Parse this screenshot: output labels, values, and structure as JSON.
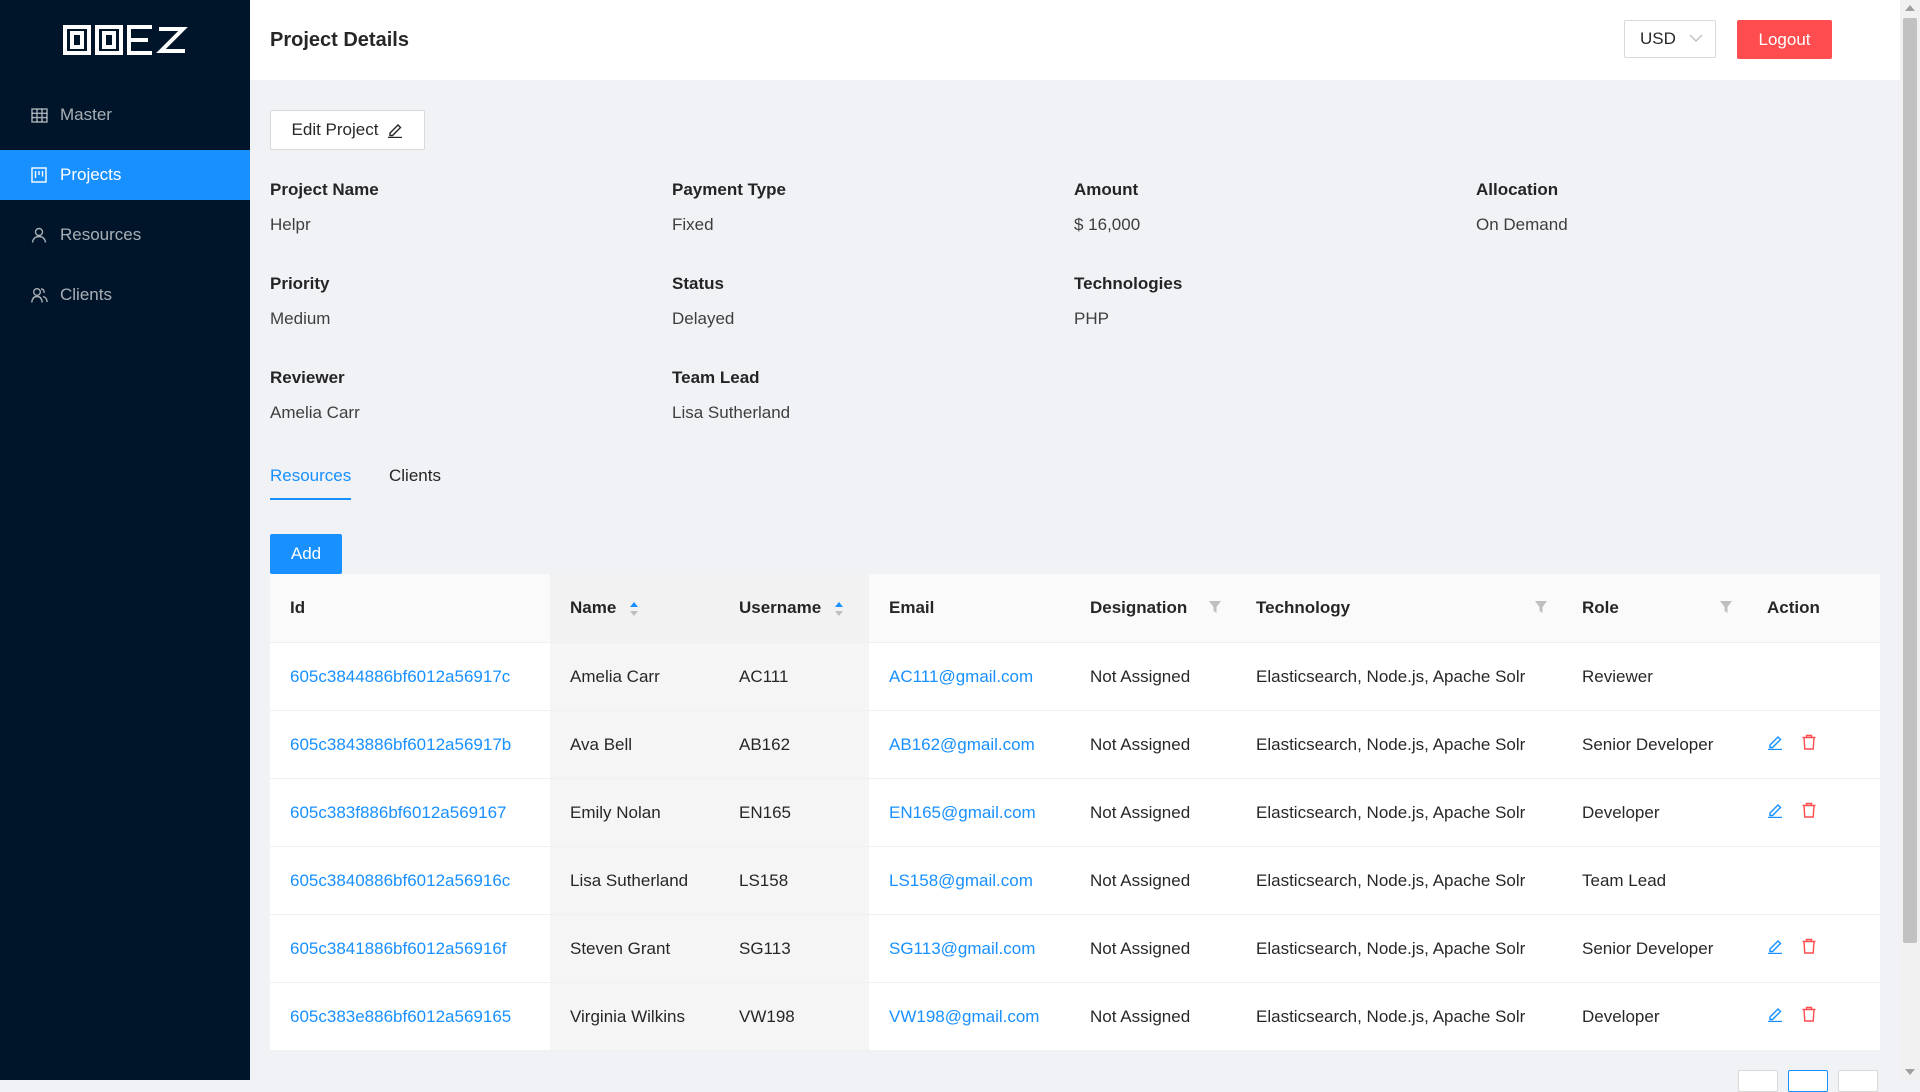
{
  "app": {
    "logo_text": "DOEZ"
  },
  "sidebar": {
    "items": [
      {
        "label": "Master",
        "icon": "table-icon"
      },
      {
        "label": "Projects",
        "icon": "project-icon"
      },
      {
        "label": "Resources",
        "icon": "user-icon"
      },
      {
        "label": "Clients",
        "icon": "team-icon"
      }
    ],
    "active": "Projects"
  },
  "header": {
    "title": "Project Details",
    "currency": "USD",
    "logout_label": "Logout"
  },
  "project": {
    "edit_label": "Edit Project",
    "fields": {
      "project_name": {
        "label": "Project Name",
        "value": "Helpr"
      },
      "payment_type": {
        "label": "Payment Type",
        "value": "Fixed"
      },
      "amount": {
        "label": "Amount",
        "value": "$ 16,000"
      },
      "allocation": {
        "label": "Allocation",
        "value": "On Demand"
      },
      "priority": {
        "label": "Priority",
        "value": "Medium"
      },
      "status": {
        "label": "Status",
        "value": "Delayed"
      },
      "technologies": {
        "label": "Technologies",
        "value": "PHP"
      },
      "reviewer": {
        "label": "Reviewer",
        "value": "Amelia Carr"
      },
      "team_lead": {
        "label": "Team Lead",
        "value": "Lisa Sutherland"
      }
    }
  },
  "tabs": [
    {
      "label": "Resources",
      "active": true
    },
    {
      "label": "Clients",
      "active": false
    }
  ],
  "add_label": "Add",
  "table": {
    "columns": [
      "Id",
      "Name",
      "Username",
      "Email",
      "Designation",
      "Technology",
      "Role",
      "Action"
    ],
    "rows": [
      {
        "id": "605c3844886bf6012a56917c",
        "name": "Amelia Carr",
        "username": "AC111",
        "email": "AC111@gmail.com",
        "designation": "Not Assigned",
        "technology": "Elasticsearch, Node.js, Apache Solr",
        "role": "Reviewer",
        "actions": false
      },
      {
        "id": "605c3843886bf6012a56917b",
        "name": "Ava Bell",
        "username": "AB162",
        "email": "AB162@gmail.com",
        "designation": "Not Assigned",
        "technology": "Elasticsearch, Node.js, Apache Solr",
        "role": "Senior Developer",
        "actions": true
      },
      {
        "id": "605c383f886bf6012a569167",
        "name": "Emily Nolan",
        "username": "EN165",
        "email": "EN165@gmail.com",
        "designation": "Not Assigned",
        "technology": "Elasticsearch, Node.js, Apache Solr",
        "role": "Developer",
        "actions": true
      },
      {
        "id": "605c3840886bf6012a56916c",
        "name": "Lisa Sutherland",
        "username": "LS158",
        "email": "LS158@gmail.com",
        "designation": "Not Assigned",
        "technology": "Elasticsearch, Node.js, Apache Solr",
        "role": "Team Lead",
        "actions": false
      },
      {
        "id": "605c3841886bf6012a56916f",
        "name": "Steven Grant",
        "username": "SG113",
        "email": "SG113@gmail.com",
        "designation": "Not Assigned",
        "technology": "Elasticsearch, Node.js, Apache Solr",
        "role": "Senior Developer",
        "actions": true
      },
      {
        "id": "605c383e886bf6012a569165",
        "name": "Virginia Wilkins",
        "username": "VW198",
        "email": "VW198@gmail.com",
        "designation": "Not Assigned",
        "technology": "Elasticsearch, Node.js, Apache Solr",
        "role": "Developer",
        "actions": true
      }
    ]
  },
  "colors": {
    "primary": "#1890ff",
    "danger": "#ff4d4f",
    "sidebar": "#001529"
  }
}
